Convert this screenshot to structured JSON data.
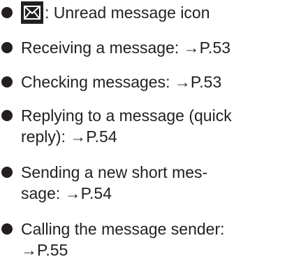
{
  "items": [
    {
      "icon": "unread-message-icon",
      "text": ": Unread message icon"
    },
    {
      "text": "Receiving a message: →P.53"
    },
    {
      "text": "Checking messages: →P.53"
    },
    {
      "line1": "Replying to a message (quick",
      "line2": "reply): →P.54"
    },
    {
      "line1": "Sending a new short mes-",
      "line2": "sage: →P.54"
    },
    {
      "line1": "Calling the message sender:",
      "line2": "→P.55"
    }
  ],
  "colors": {
    "text": "#231f20",
    "icon_bg": "#231f20",
    "icon_fg": "#ffffff"
  }
}
